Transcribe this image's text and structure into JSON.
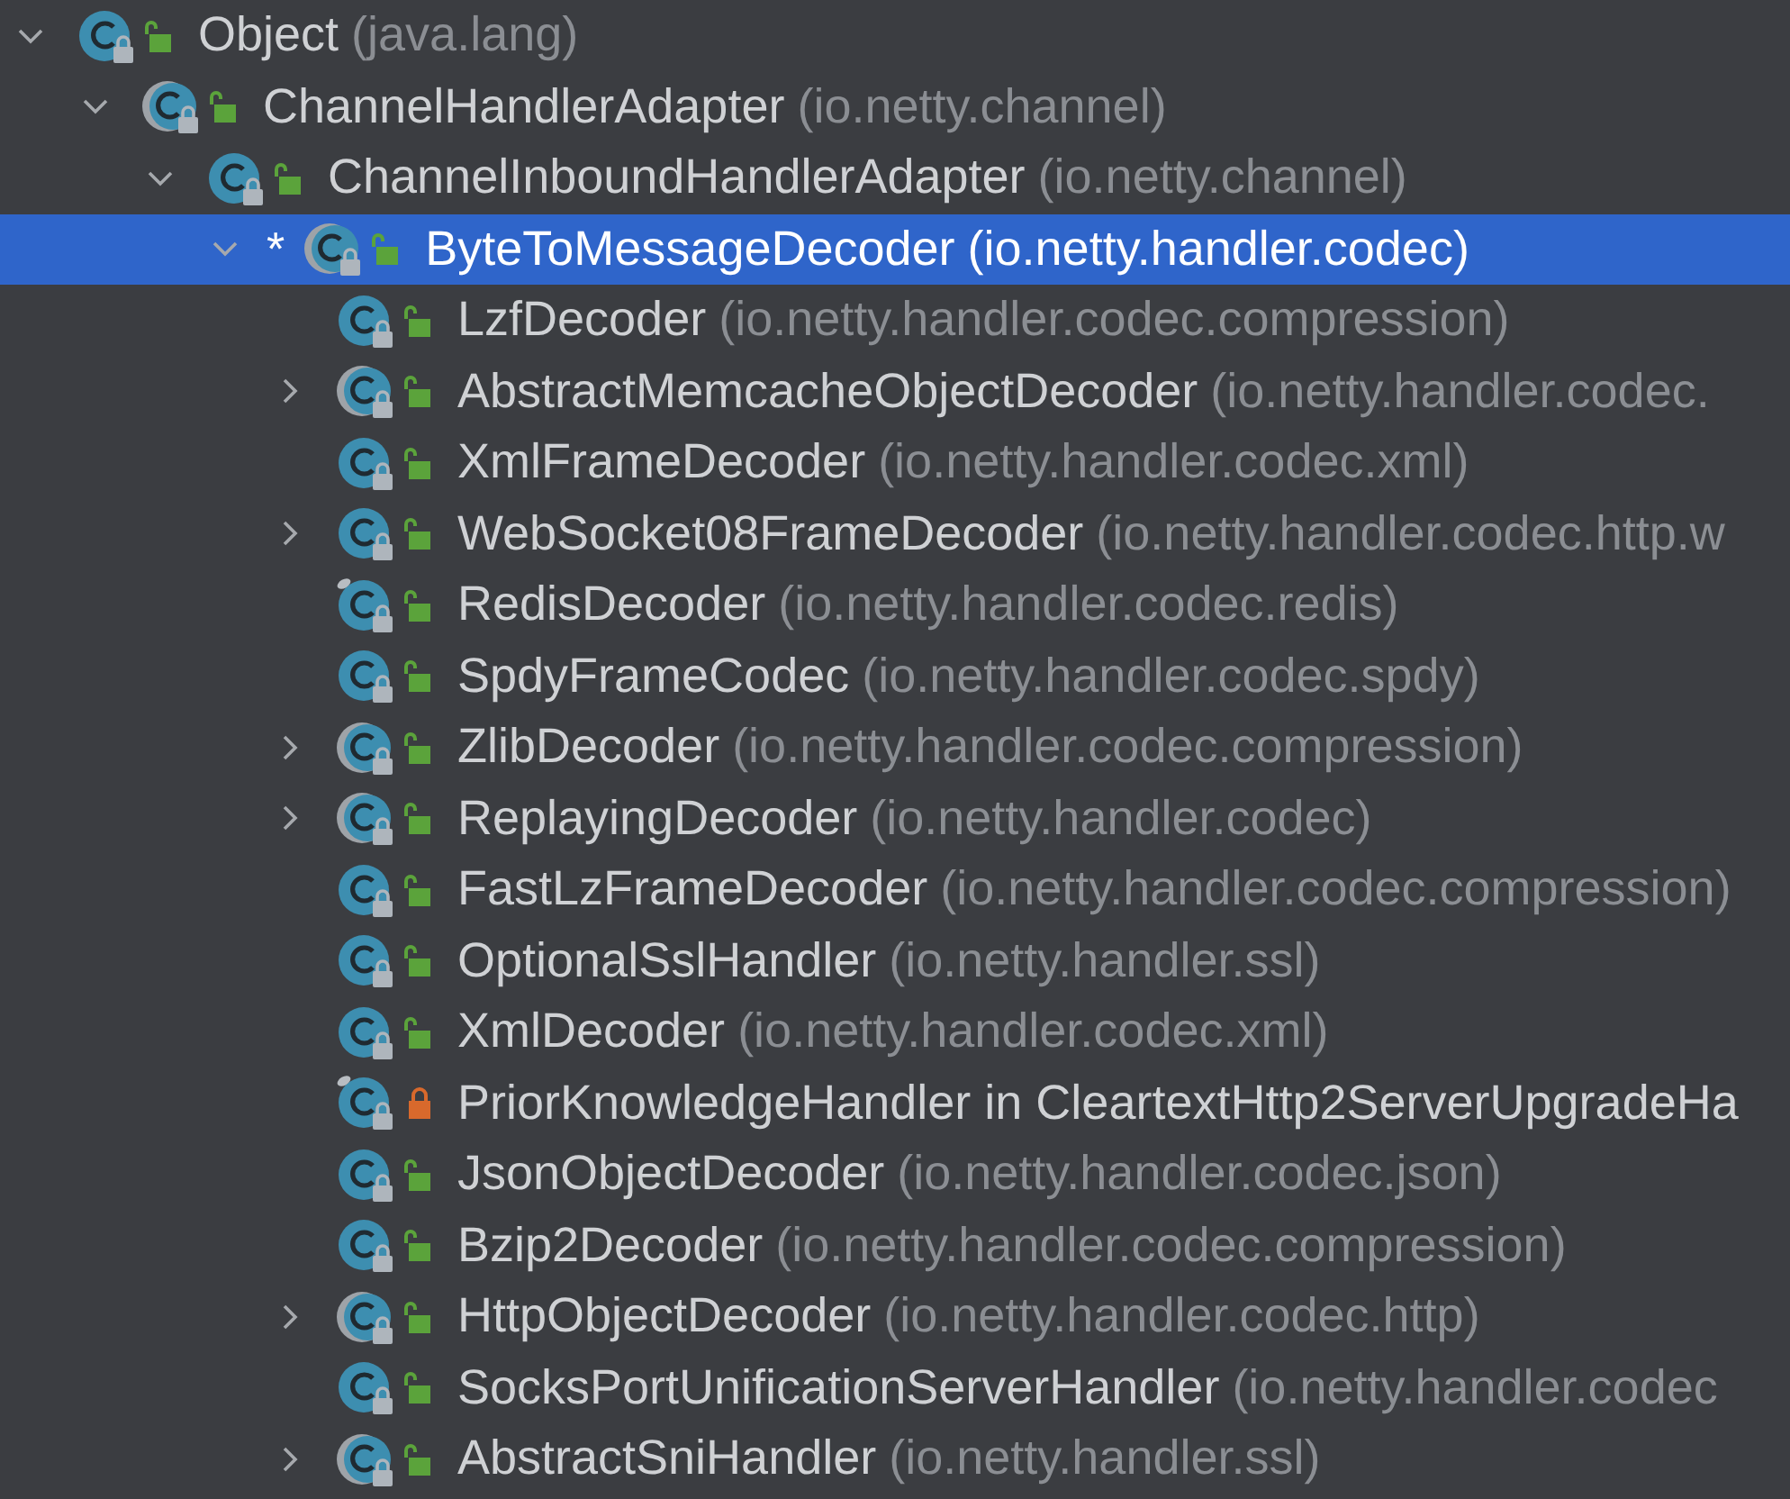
{
  "tree": [
    {
      "name": "Object",
      "package": "(java.lang)",
      "abstract": false,
      "pinned": false,
      "private": false,
      "expanded": true,
      "selected": false,
      "children": [
        {
          "name": "ChannelHandlerAdapter",
          "package": "(io.netty.channel)",
          "abstract": true,
          "pinned": false,
          "private": false,
          "expanded": true,
          "selected": false,
          "children": [
            {
              "name": "ChannelInboundHandlerAdapter",
              "package": "(io.netty.channel)",
              "abstract": false,
              "pinned": false,
              "private": false,
              "expanded": true,
              "selected": false,
              "children": [
                {
                  "name": "ByteToMessageDecoder",
                  "package": "(io.netty.handler.codec)",
                  "mark": "*",
                  "abstract": true,
                  "pinned": false,
                  "private": false,
                  "expanded": true,
                  "selected": true,
                  "children": [
                    {
                      "name": "LzfDecoder",
                      "package": "(io.netty.handler.codec.compression)",
                      "abstract": false,
                      "pinned": false,
                      "private": false,
                      "selected": false
                    },
                    {
                      "name": "AbstractMemcacheObjectDecoder",
                      "package": "(io.netty.handler.codec.",
                      "abstract": true,
                      "pinned": false,
                      "private": false,
                      "expanded": false,
                      "selected": false
                    },
                    {
                      "name": "XmlFrameDecoder",
                      "package": "(io.netty.handler.codec.xml)",
                      "abstract": false,
                      "pinned": false,
                      "private": false,
                      "selected": false
                    },
                    {
                      "name": "WebSocket08FrameDecoder",
                      "package": "(io.netty.handler.codec.http.w",
                      "abstract": false,
                      "pinned": false,
                      "private": false,
                      "expanded": false,
                      "selected": false
                    },
                    {
                      "name": "RedisDecoder",
                      "package": "(io.netty.handler.codec.redis)",
                      "abstract": false,
                      "pinned": true,
                      "private": false,
                      "selected": false
                    },
                    {
                      "name": "SpdyFrameCodec",
                      "package": "(io.netty.handler.codec.spdy)",
                      "abstract": false,
                      "pinned": false,
                      "private": false,
                      "selected": false
                    },
                    {
                      "name": "ZlibDecoder",
                      "package": "(io.netty.handler.codec.compression)",
                      "abstract": true,
                      "pinned": false,
                      "private": false,
                      "expanded": false,
                      "selected": false
                    },
                    {
                      "name": "ReplayingDecoder",
                      "package": "(io.netty.handler.codec)",
                      "abstract": true,
                      "pinned": false,
                      "private": false,
                      "expanded": false,
                      "selected": false
                    },
                    {
                      "name": "FastLzFrameDecoder",
                      "package": "(io.netty.handler.codec.compression)",
                      "abstract": false,
                      "pinned": false,
                      "private": false,
                      "selected": false
                    },
                    {
                      "name": "OptionalSslHandler",
                      "package": "(io.netty.handler.ssl)",
                      "abstract": false,
                      "pinned": false,
                      "private": false,
                      "selected": false
                    },
                    {
                      "name": "XmlDecoder",
                      "package": "(io.netty.handler.codec.xml)",
                      "abstract": false,
                      "pinned": false,
                      "private": false,
                      "selected": false
                    },
                    {
                      "name": "PriorKnowledgeHandler in CleartextHttp2ServerUpgradeHa",
                      "abstract": false,
                      "pinned": true,
                      "private": true,
                      "selected": false
                    },
                    {
                      "name": "JsonObjectDecoder",
                      "package": "(io.netty.handler.codec.json)",
                      "abstract": false,
                      "pinned": false,
                      "private": false,
                      "selected": false
                    },
                    {
                      "name": "Bzip2Decoder",
                      "package": "(io.netty.handler.codec.compression)",
                      "abstract": false,
                      "pinned": false,
                      "private": false,
                      "selected": false
                    },
                    {
                      "name": "HttpObjectDecoder",
                      "package": "(io.netty.handler.codec.http)",
                      "abstract": true,
                      "pinned": false,
                      "private": false,
                      "expanded": false,
                      "selected": false
                    },
                    {
                      "name": "SocksPortUnificationServerHandler",
                      "package": "(io.netty.handler.codec",
                      "abstract": false,
                      "pinned": false,
                      "private": false,
                      "selected": false
                    },
                    {
                      "name": "AbstractSniHandler",
                      "package": "(io.netty.handler.ssl)",
                      "abstract": true,
                      "pinned": false,
                      "private": false,
                      "expanded": false,
                      "selected": false
                    }
                  ]
                }
              ]
            }
          ]
        }
      ]
    }
  ]
}
